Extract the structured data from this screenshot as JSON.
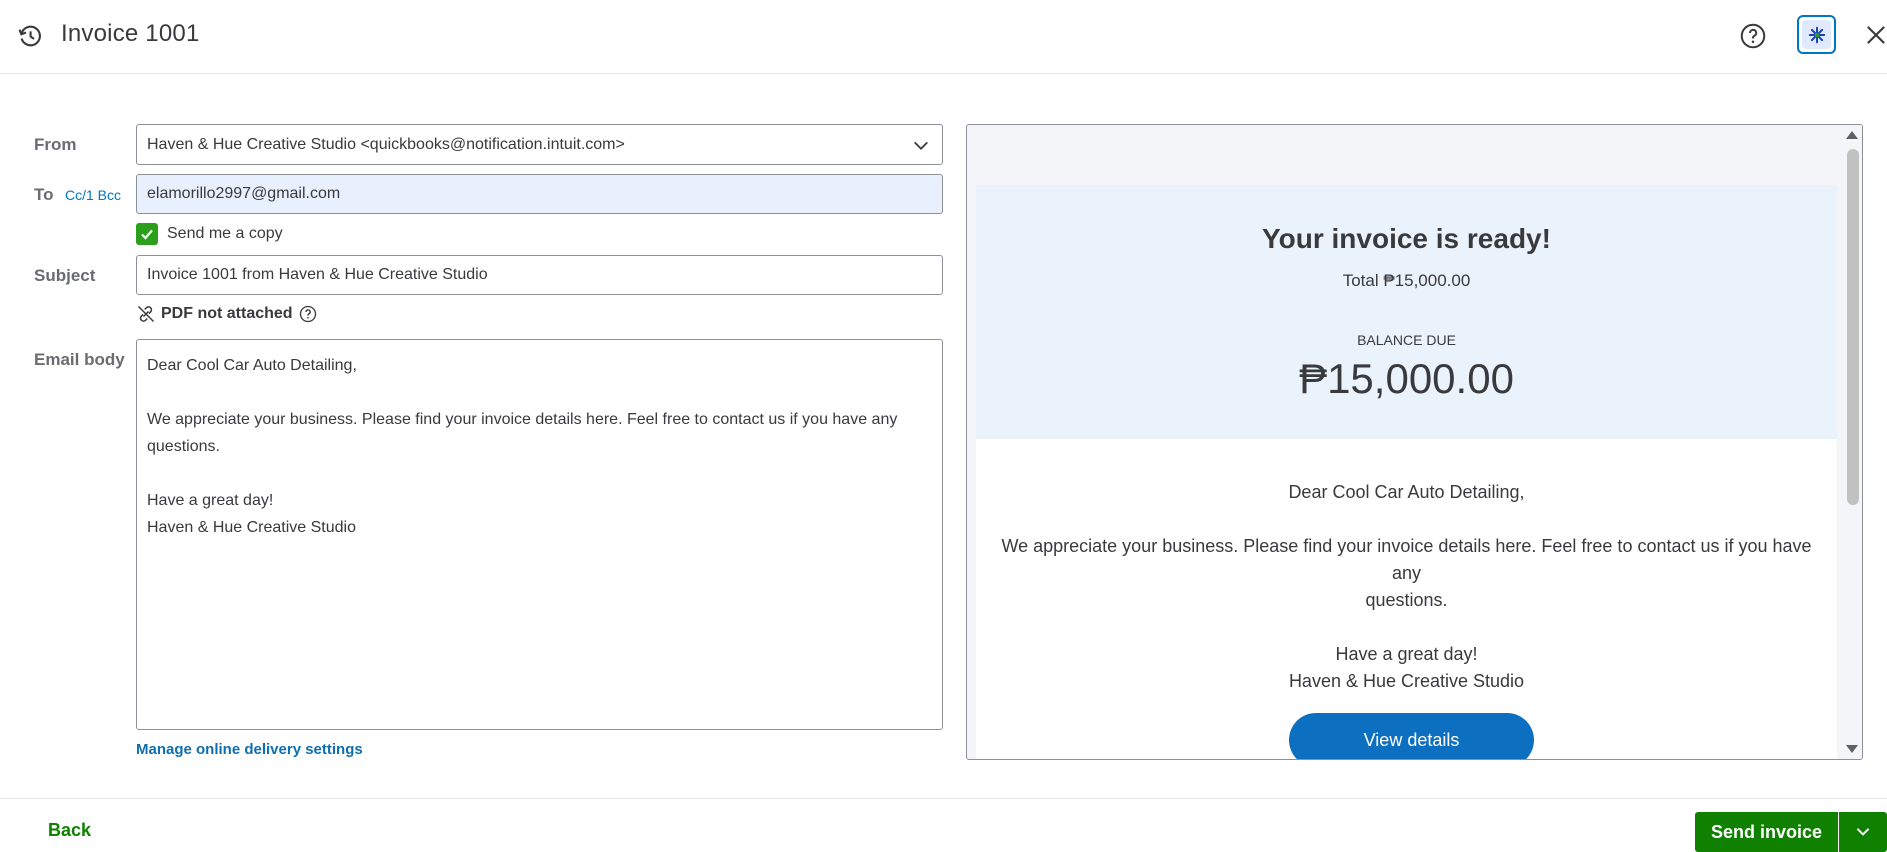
{
  "header": {
    "title": "Invoice 1001",
    "icons": [
      "history-icon",
      "help-icon",
      "assistant-icon",
      "close-icon"
    ]
  },
  "form": {
    "from_label": "From",
    "from_value": "Haven & Hue Creative Studio <quickbooks@notification.intuit.com>",
    "to_label": "To",
    "cc_bcc_label": "Cc/1 Bcc",
    "to_value": "elamorillo2997@gmail.com",
    "send_copy_label": "Send me a copy",
    "send_copy_checked": true,
    "subject_label": "Subject",
    "subject_value": "Invoice 1001 from Haven & Hue Creative Studio",
    "pdf_status": "PDF not attached",
    "body_label": "Email body",
    "body": {
      "greeting": "Dear Cool Car Auto Detailing,",
      "line1": "We appreciate your business. Please find your invoice details here. Feel free to contact us if you have any",
      "line2": "questions.",
      "closing": "Have a great day!",
      "signature": "Haven & Hue Creative Studio"
    },
    "manage_link": "Manage online delivery settings"
  },
  "preview": {
    "heading": "Your invoice is ready!",
    "total": "Total ₱15,000.00",
    "balance_label": "BALANCE DUE",
    "balance_value": "₱15,000.00",
    "greeting": "Dear Cool Car Auto Detailing,",
    "line1": "We appreciate your business. Please find your invoice details here. Feel free to contact us if you have any",
    "line2": "questions.",
    "closing": "Have a great day!",
    "signature": "Haven & Hue Creative Studio",
    "view_button": "View details"
  },
  "footer": {
    "back_label": "Back",
    "send_label": "Send invoice"
  },
  "colors": {
    "primary_green": "#108000",
    "checkbox_green": "#2ca01c",
    "link_blue": "#0077c5",
    "view_button_blue": "#0d6fbf",
    "hero_bg": "#eaf2fb"
  }
}
